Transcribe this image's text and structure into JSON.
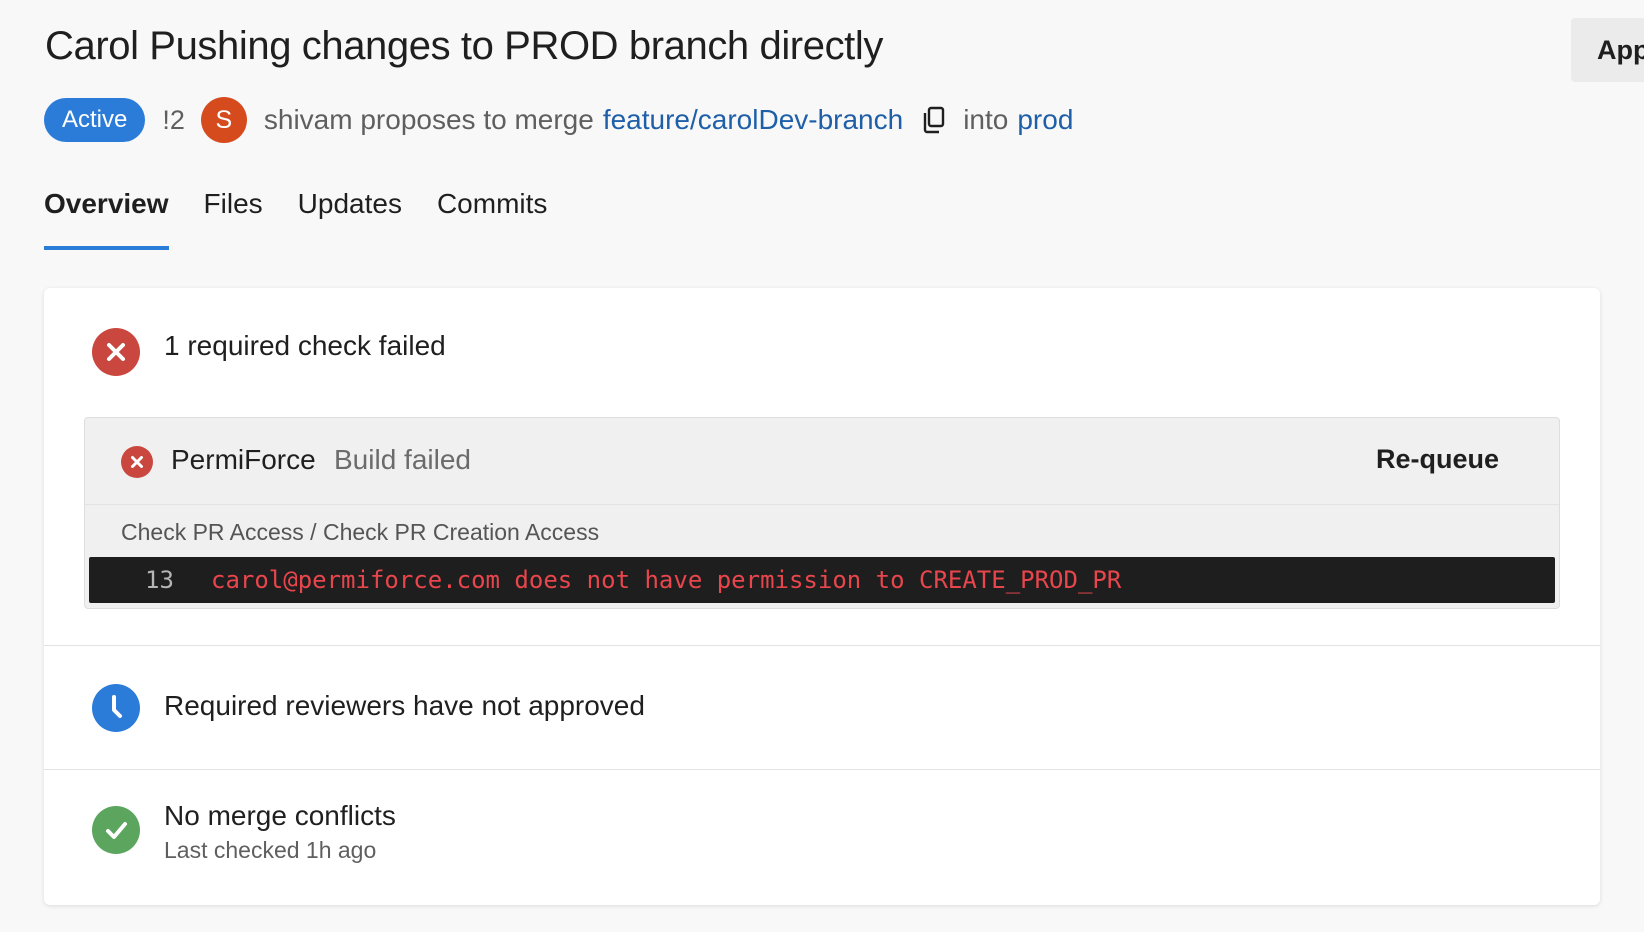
{
  "header": {
    "title": "Carol Pushing changes to PROD branch directly",
    "approve_label": "App"
  },
  "meta": {
    "status_badge": "Active",
    "pr_number": "!2",
    "avatar_initial": "S",
    "proposer_text": "shivam proposes to merge",
    "source_branch": "feature/carolDev-branch",
    "into_text": "into",
    "target_branch": "prod"
  },
  "tabs": [
    {
      "label": "Overview",
      "active": true
    },
    {
      "label": "Files",
      "active": false
    },
    {
      "label": "Updates",
      "active": false
    },
    {
      "label": "Commits",
      "active": false
    }
  ],
  "checks": {
    "summary": "1 required check failed",
    "check_name": "PermiForce",
    "check_status": "Build failed",
    "requeue_label": "Re-queue",
    "check_path": "Check PR Access / Check PR Creation Access",
    "log_line_number": "13",
    "log_text": "carol@permiforce.com does not have permission to CREATE_PROD_PR"
  },
  "reviewers": {
    "text": "Required reviewers have not approved"
  },
  "conflicts": {
    "text": "No merge conflicts",
    "subtext": "Last checked 1h ago"
  },
  "colors": {
    "accent_blue": "#2b7bd9",
    "link_blue": "#1f5fa8",
    "error_red": "#c9473f",
    "success_green": "#5ba55f",
    "avatar_orange": "#d64b1e"
  },
  "icons": {
    "failed": "error-x-icon",
    "pending": "clock-icon",
    "success": "check-icon",
    "copy": "copy-icon"
  }
}
